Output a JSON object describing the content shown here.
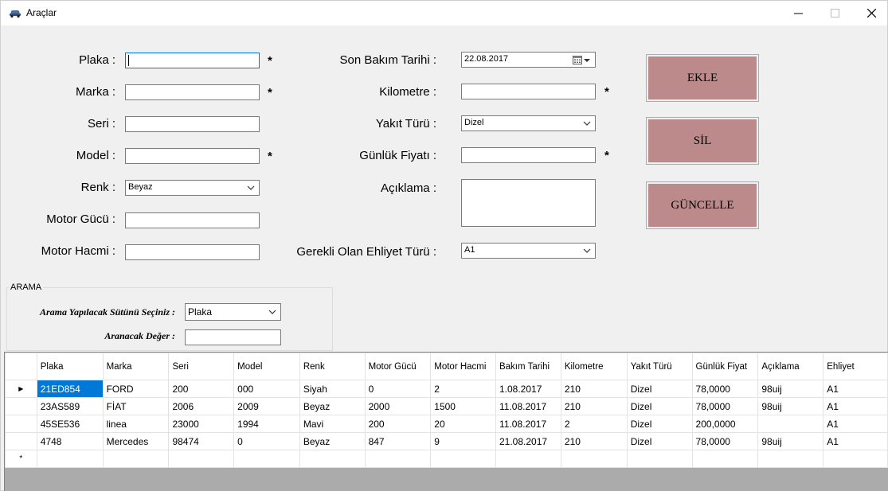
{
  "window": {
    "title": "Araçlar",
    "icon": "car-icon",
    "minimize": "—",
    "maximize": "☐",
    "close": "✕"
  },
  "form": {
    "plaka_label": "Plaka :",
    "plaka_value": "",
    "marka_label": "Marka :",
    "marka_value": "",
    "seri_label": "Seri :",
    "seri_value": "",
    "model_label": "Model :",
    "model_value": "",
    "renk_label": "Renk :",
    "renk_value": "Beyaz",
    "motor_gucu_label": "Motor Gücü :",
    "motor_gucu_value": "",
    "motor_hacmi_label": "Motor Hacmi :",
    "motor_hacmi_value": "",
    "son_bakim_label": "Son Bakım Tarihi :",
    "son_bakim_value": "22.08.2017",
    "kilometre_label": "Kilometre :",
    "kilometre_value": "",
    "yakit_label": "Yakıt Türü :",
    "yakit_value": "Dizel",
    "gunluk_fiyat_label": "Günlük Fiyatı :",
    "gunluk_fiyat_value": "",
    "aciklama_label": "Açıklama :",
    "aciklama_value": "",
    "ehliyet_label": "Gerekli Olan Ehliyet Türü :",
    "ehliyet_value": "A1",
    "required_mark": "*"
  },
  "buttons": {
    "ekle": "EKLE",
    "sil": "SİL",
    "guncelle": "GÜNCELLE"
  },
  "search": {
    "group_title": "ARAMA",
    "column_label": "Arama Yapılacak Sütünü Seçiniz :",
    "column_value": "Plaka",
    "value_label": "Aranacak Değer :",
    "value_value": ""
  },
  "grid": {
    "columns": [
      "Plaka",
      "Marka",
      "Seri",
      "Model",
      "Renk",
      "Motor Gücü",
      "Motor Hacmi",
      "Bakım Tarihi",
      "Kilometre",
      "Yakıt Türü",
      "Günlük Fiyat",
      "Açıklama",
      "Ehliyet"
    ],
    "rows": [
      [
        "21ED854",
        "FORD",
        "200",
        "000",
        "Siyah",
        "0",
        "2",
        "1.08.2017",
        "210",
        "Dizel",
        "78,0000",
        "98uij",
        "A1"
      ],
      [
        "23AS589",
        "FİAT",
        "2006",
        "2009",
        "Beyaz",
        "2000",
        "1500",
        "11.08.2017",
        "210",
        "Dizel",
        "78,0000",
        "98uij",
        "A1"
      ],
      [
        "45SE536",
        "linea",
        "23000",
        "1994",
        "Mavi",
        "200",
        "20",
        "11.08.2017",
        "2",
        "Dizel",
        "200,0000",
        "",
        "A1"
      ],
      [
        "4748",
        "Mercedes",
        "98474",
        "0",
        "Beyaz",
        "847",
        "9",
        "21.08.2017",
        "210",
        "Dizel",
        "78,0000",
        "98uij",
        "A1"
      ]
    ],
    "current_row_marker": "▶",
    "new_row_marker": "*"
  }
}
